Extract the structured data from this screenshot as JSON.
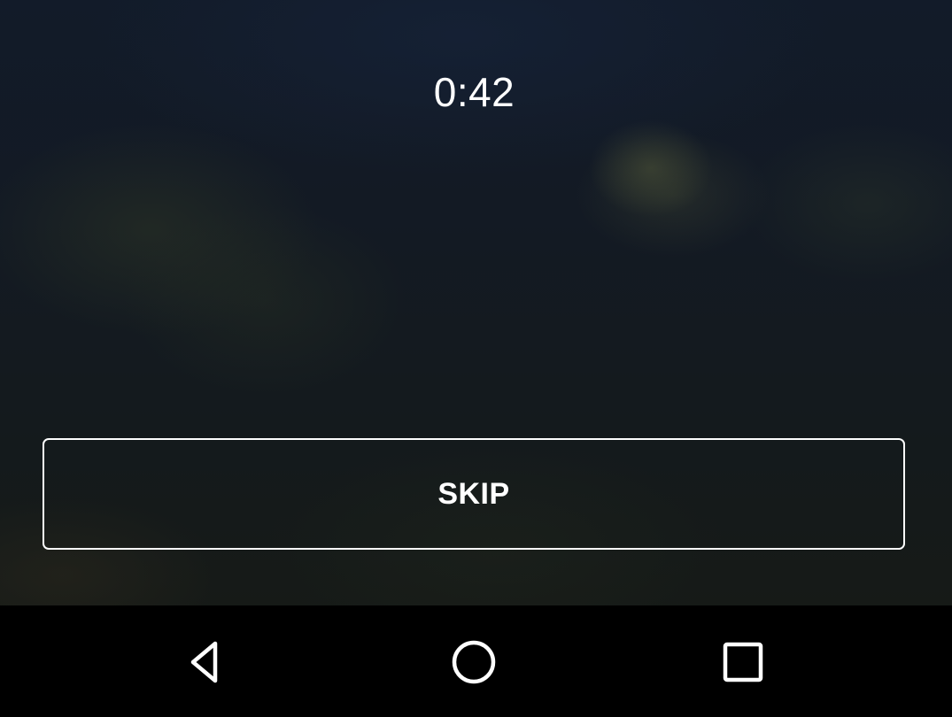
{
  "countdown": {
    "value": "0:42"
  },
  "actions": {
    "skip_label": "SKIP"
  },
  "navigation_bar": {
    "back_icon": "back-triangle-icon",
    "home_icon": "home-circle-icon",
    "recents_icon": "recents-square-icon"
  },
  "colors": {
    "text": "#ffffff",
    "button_border": "#ffffff",
    "nav_background": "#000000"
  }
}
